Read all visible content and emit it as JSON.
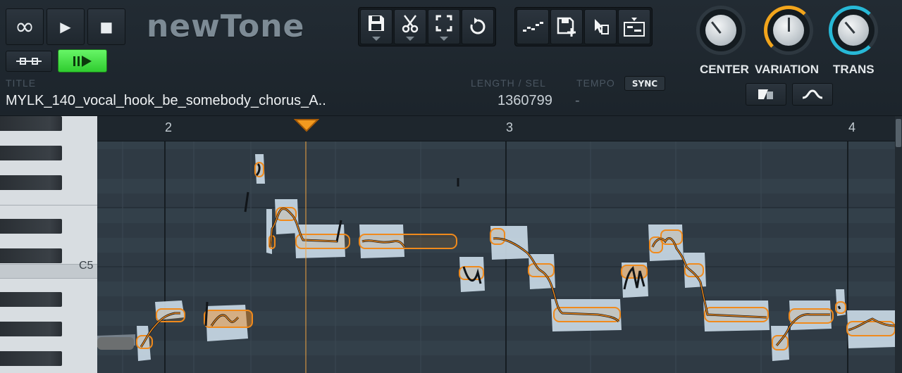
{
  "app": {
    "logo": "newTone"
  },
  "transport": {
    "loop_glyph": "∞",
    "play_glyph": "▶",
    "stop_glyph": "■"
  },
  "info": {
    "title_label": "TITLE",
    "title_value": "MYLK_140_vocal_hook_be_somebody_chorus_A..",
    "length_label": "LENGTH / SEL",
    "length_value": "1360799",
    "tempo_label": "TEMPO",
    "tempo_value": "-",
    "sync_label": "SYNC"
  },
  "knobs": [
    {
      "name": "center",
      "label": "CENTER",
      "ring_color": "#2e3840"
    },
    {
      "name": "variation",
      "label": "VARIATION",
      "ring_color": "#f2a51c"
    },
    {
      "name": "trans",
      "label": "TRANS",
      "ring_color": "#27b8d6"
    }
  ],
  "ruler": {
    "bars": [
      "2",
      "3",
      "4"
    ]
  },
  "keyboard": {
    "c5_label": "C5"
  },
  "colors": {
    "accent_orange": "#f08a1c",
    "toggle_green": "#3be03b",
    "waveform": "#c9d9e6"
  }
}
